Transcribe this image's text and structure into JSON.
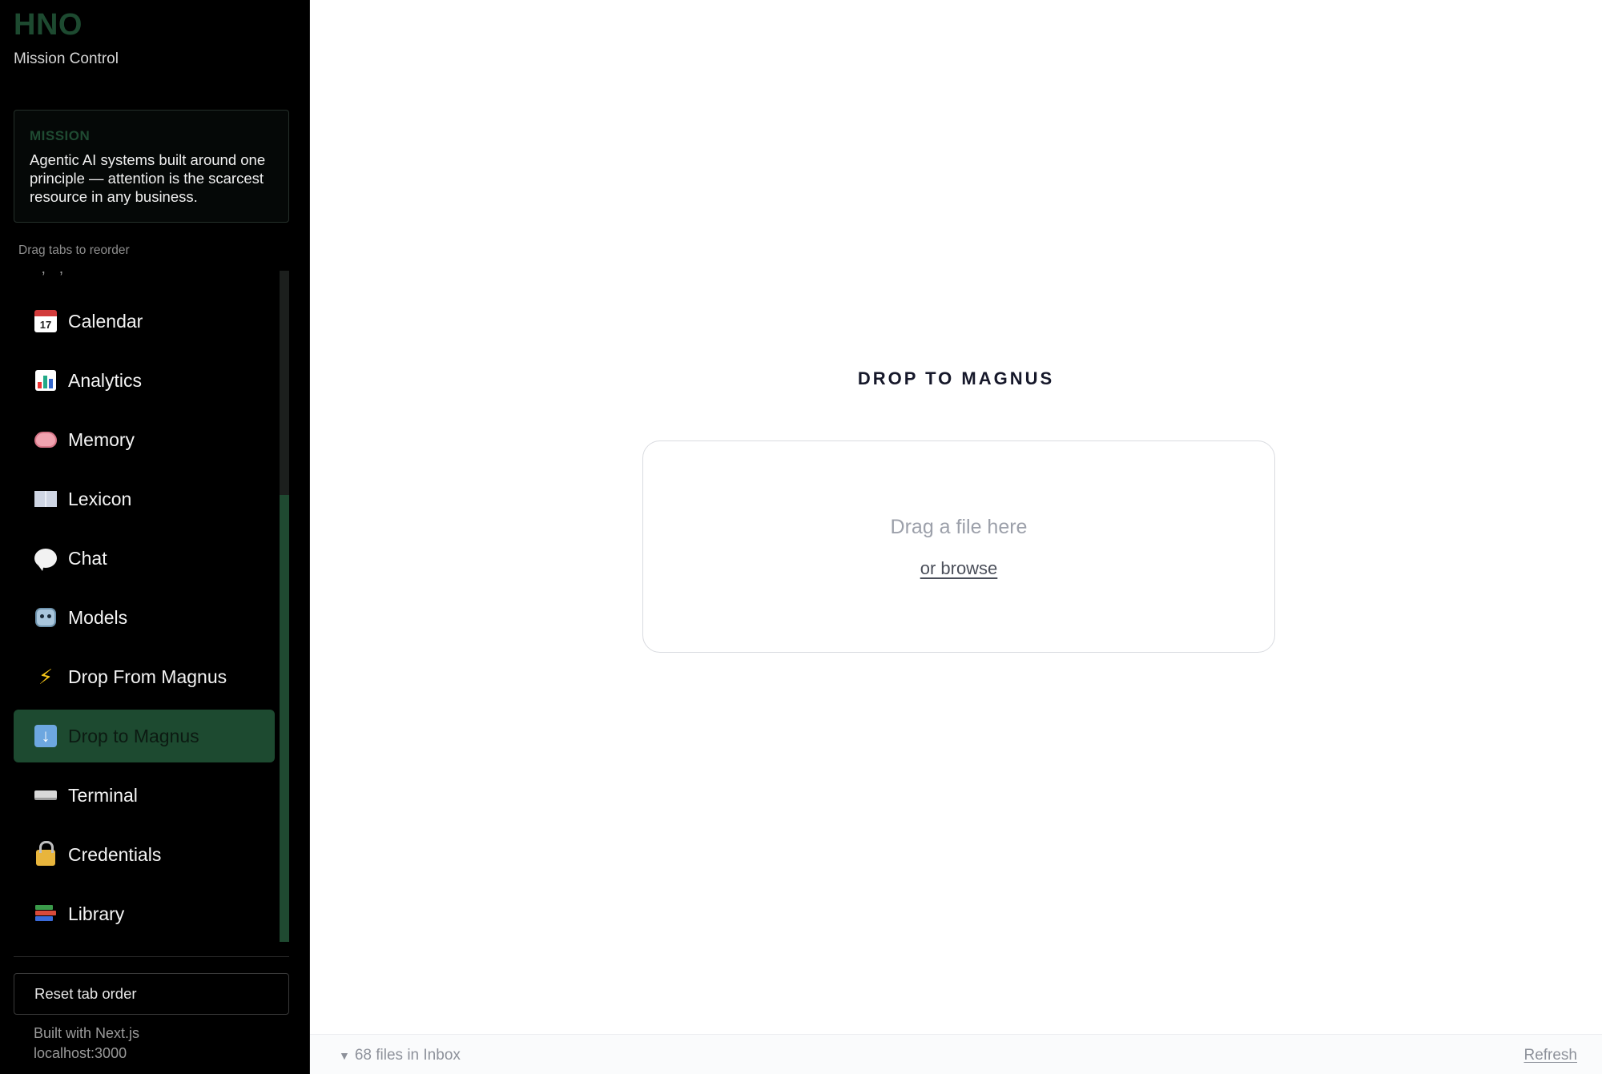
{
  "brand": {
    "title": "HNO",
    "subtitle": "Mission Control"
  },
  "mission": {
    "label": "MISSION",
    "text": "Agentic AI systems built around one principle — attention is the scarcest resource in any business."
  },
  "sidebar": {
    "drag_hint": "Drag tabs to reorder",
    "tabs": [
      {
        "label": "Calendar",
        "icon": "calendar-icon",
        "active": false
      },
      {
        "label": "Analytics",
        "icon": "bar-chart-icon",
        "active": false
      },
      {
        "label": "Memory",
        "icon": "brain-icon",
        "active": false
      },
      {
        "label": "Lexicon",
        "icon": "open-book-icon",
        "active": false
      },
      {
        "label": "Chat",
        "icon": "speech-bubble-icon",
        "active": false
      },
      {
        "label": "Models",
        "icon": "robot-icon",
        "active": false
      },
      {
        "label": "Drop From Magnus",
        "icon": "lightning-icon",
        "active": false
      },
      {
        "label": "Drop to Magnus",
        "icon": "down-arrow-icon",
        "active": true
      },
      {
        "label": "Terminal",
        "icon": "keyboard-icon",
        "active": false
      },
      {
        "label": "Credentials",
        "icon": "locked-with-key-icon",
        "active": false
      },
      {
        "label": "Library",
        "icon": "books-icon",
        "active": false
      }
    ],
    "reset_label": "Reset tab order",
    "footer_built": "Built with Next.js",
    "footer_host": "localhost:3000",
    "colors": {
      "accent": "#1d4a30",
      "background": "#000000"
    }
  },
  "main": {
    "title": "DROP TO MAGNUS",
    "dropzone": {
      "hint": "Drag a file here",
      "browse_label": "or browse"
    },
    "status": {
      "files_label": "68 files in Inbox",
      "refresh_label": "Refresh"
    }
  }
}
